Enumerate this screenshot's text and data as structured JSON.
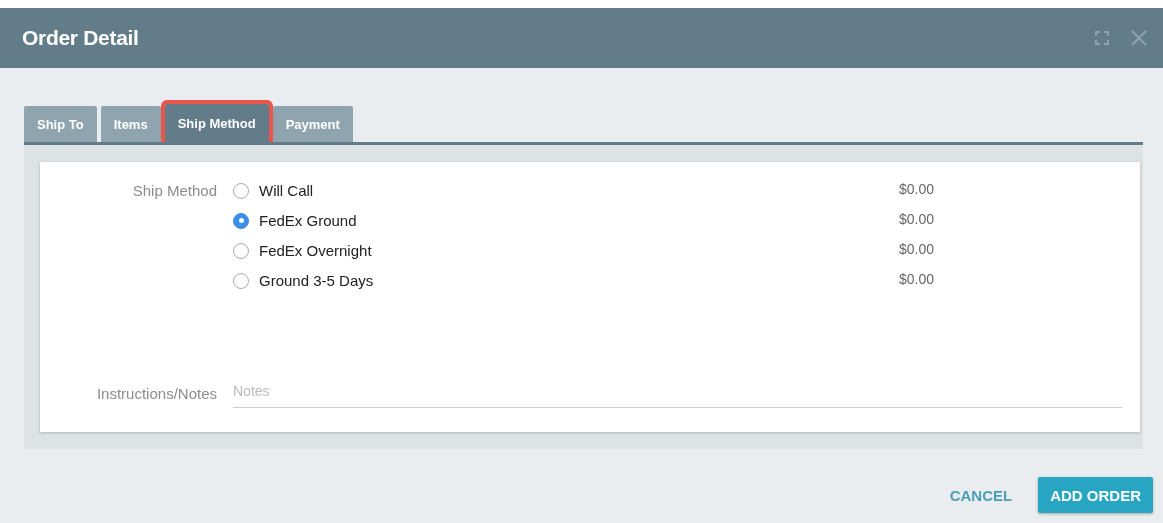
{
  "window": {
    "title": "Order Detail"
  },
  "tabs": [
    {
      "label": "Ship To",
      "selected": false
    },
    {
      "label": "Items",
      "selected": false
    },
    {
      "label": "Ship Method",
      "selected": true
    },
    {
      "label": "Payment",
      "selected": false
    }
  ],
  "ship_method": {
    "label": "Ship Method",
    "options": [
      {
        "label": "Will Call",
        "price": "$0.00",
        "selected": false
      },
      {
        "label": "FedEx Ground",
        "price": "$0.00",
        "selected": true
      },
      {
        "label": "FedEx Overnight",
        "price": "$0.00",
        "selected": false
      },
      {
        "label": "Ground 3-5 Days",
        "price": "$0.00",
        "selected": false
      }
    ]
  },
  "notes": {
    "label": "Instructions/Notes",
    "placeholder": "Notes"
  },
  "buttons": [
    {
      "label": "CANCEL",
      "kind": "flat"
    },
    {
      "label": "ADD ORDER",
      "kind": "raised"
    }
  ]
}
